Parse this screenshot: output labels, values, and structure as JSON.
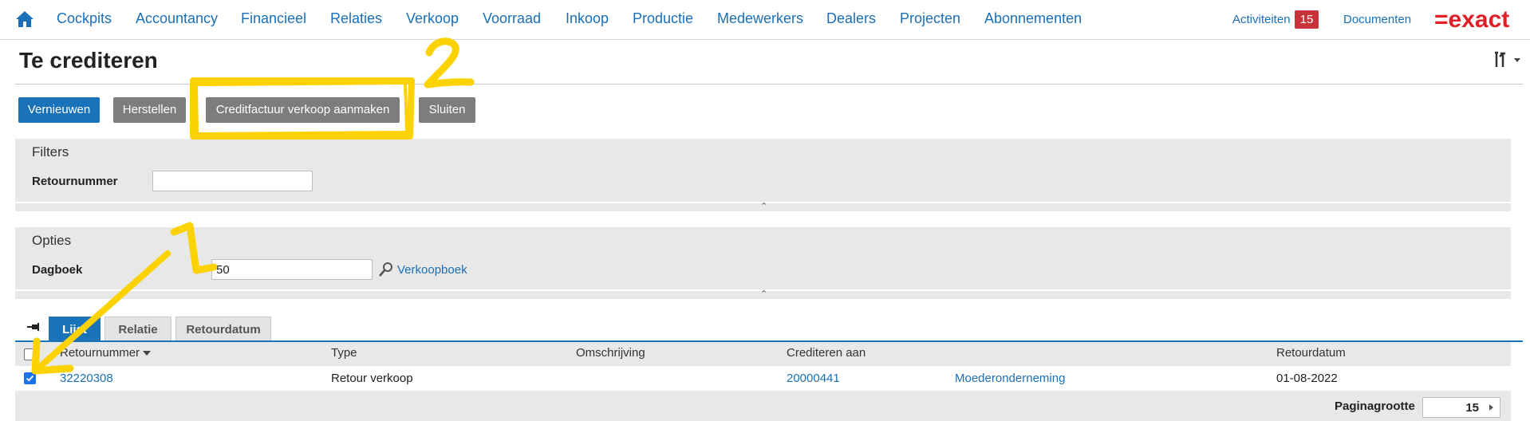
{
  "nav": {
    "items": [
      "Cockpits",
      "Accountancy",
      "Financieel",
      "Relaties",
      "Verkoop",
      "Voorraad",
      "Inkoop",
      "Productie",
      "Medewerkers",
      "Dealers",
      "Projecten",
      "Abonnementen"
    ],
    "activities_label": "Activiteiten",
    "activities_count": "15",
    "documents_label": "Documenten",
    "logo_text": "=exact"
  },
  "page": {
    "title": "Te crediteren"
  },
  "toolbar": {
    "refresh": "Vernieuwen",
    "reset": "Herstellen",
    "create_credit": "Creditfactuur verkoop aanmaken",
    "close": "Sluiten"
  },
  "filters": {
    "title": "Filters",
    "return_number_label": "Retournummer",
    "return_number_value": ""
  },
  "options": {
    "title": "Opties",
    "journal_label": "Dagboek",
    "journal_value": "50",
    "journal_link": "Verkoopboek"
  },
  "tabs": [
    "Lijst",
    "Relatie",
    "Retourdatum"
  ],
  "table": {
    "headers": [
      "Retournummer",
      "Type",
      "Omschrijving",
      "Crediteren aan",
      "",
      "Retourdatum"
    ],
    "rows": [
      {
        "checked": true,
        "number": "32220308",
        "type": "Retour verkoop",
        "description": "",
        "credit_to_code": "20000441",
        "credit_to_name": "Moederonderneming",
        "date": "01-08-2022"
      }
    ]
  },
  "footer": {
    "page_size_label": "Paginagrootte",
    "page_size_value": "15"
  },
  "colors": {
    "accent": "#1a73b9",
    "badge": "#c8333a",
    "logo": "#e41e26",
    "annotation": "#fcd200"
  }
}
